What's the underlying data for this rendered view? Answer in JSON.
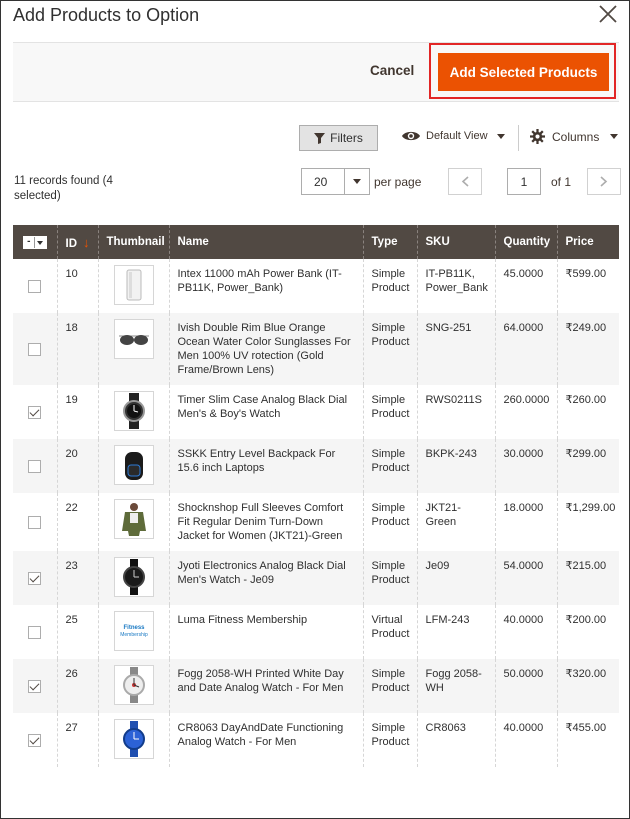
{
  "modal": {
    "title": "Add Products to Option",
    "cancel_label": "Cancel",
    "add_label": "Add Selected Products"
  },
  "toolbar": {
    "filters_label": "Filters",
    "view_label": "Default View",
    "columns_label": "Columns"
  },
  "pager": {
    "records_text": "11 records found (4 selected)",
    "per_page_value": "20",
    "per_page_label": "per page",
    "current_page": "1",
    "of_label": "of 1"
  },
  "grid": {
    "headers": [
      "ID",
      "Thumbnail",
      "Name",
      "Type",
      "SKU",
      "Quantity",
      "Price"
    ],
    "sort_indicator": "↓",
    "rows": [
      {
        "checked": false,
        "id": "10",
        "thumb": "power-bank-thumbnail-icon",
        "name": "Intex 11000 mAh Power Bank (IT-PB11K, Power_Bank)",
        "type": "Simple Product",
        "sku": "IT-PB11K, Power_Bank",
        "qty": "45.0000",
        "price": "₹599.00"
      },
      {
        "checked": false,
        "id": "18",
        "thumb": "sunglasses-thumbnail-icon",
        "name": "Ivish Double Rim Blue Orange Ocean Water Color Sunglasses For Men 100% UV rotection (Gold Frame/Brown Lens)",
        "type": "Simple Product",
        "sku": "SNG-251",
        "qty": "64.0000",
        "price": "₹249.00"
      },
      {
        "checked": true,
        "id": "19",
        "thumb": "watch-thumbnail-icon",
        "name": "Timer Slim Case Analog Black Dial Men's & Boy's Watch",
        "type": "Simple Product",
        "sku": "RWS0211S",
        "qty": "260.0000",
        "price": "₹260.00"
      },
      {
        "checked": false,
        "id": "20",
        "thumb": "backpack-thumbnail-icon",
        "name": "SSKK Entry Level Backpack For 15.6 inch Laptops",
        "type": "Simple Product",
        "sku": "BKPK-243",
        "qty": "30.0000",
        "price": "₹299.00"
      },
      {
        "checked": false,
        "id": "22",
        "thumb": "jacket-thumbnail-icon",
        "name": "Shocknshop Full Sleeves Comfort Fit Regular Denim Turn-Down Jacket for Women (JKT21)-Green",
        "type": "Simple Product",
        "sku": "JKT21-Green",
        "qty": "18.0000",
        "price": "₹1,299.00"
      },
      {
        "checked": true,
        "id": "23",
        "thumb": "black-watch-thumbnail-icon",
        "name": "Jyoti Electronics Analog Black Dial Men's Watch - Je09",
        "type": "Simple Product",
        "sku": "Je09",
        "qty": "54.0000",
        "price": "₹215.00"
      },
      {
        "checked": false,
        "id": "25",
        "thumb": "fitness-membership-thumbnail-icon",
        "name": "Luma Fitness Membership",
        "type": "Virtual Product",
        "sku": "LFM-243",
        "qty": "40.0000",
        "price": "₹200.00"
      },
      {
        "checked": true,
        "id": "26",
        "thumb": "white-watch-thumbnail-icon",
        "name": "Fogg 2058-WH Printed White Day and Date Analog Watch - For Men",
        "type": "Simple Product",
        "sku": "Fogg 2058-WH",
        "qty": "50.0000",
        "price": "₹320.00"
      },
      {
        "checked": true,
        "id": "27",
        "thumb": "blue-watch-thumbnail-icon",
        "name": "CR8063 DayAndDate Functioning Analog Watch - For Men",
        "type": "Simple Product",
        "sku": "CR8063",
        "qty": "40.0000",
        "price": "₹455.00"
      }
    ]
  },
  "thumb_text": {
    "fitness_line1": "Fitness",
    "fitness_line2": "Membership"
  },
  "colors": {
    "primary_button": "#eb5202",
    "header_bg": "#514943",
    "highlight": "#e22626"
  }
}
